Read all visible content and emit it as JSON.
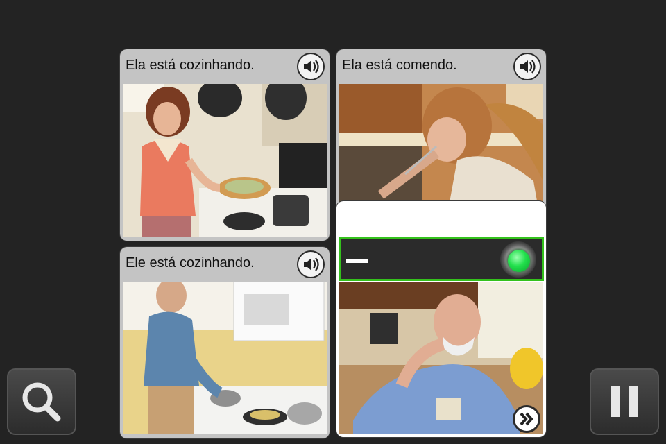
{
  "cards": [
    {
      "caption": "Ela está cozinhando.",
      "icon": "speaker-icon"
    },
    {
      "caption": "Ela está comendo.",
      "icon": "speaker-icon"
    },
    {
      "caption": "Ele está cozinhando.",
      "icon": "speaker-icon"
    }
  ],
  "answer": {
    "text": "—",
    "status_icon": "green-light-icon",
    "accent": "#34c11c"
  },
  "controls": {
    "zoom_icon": "magnifier-icon",
    "pause_icon": "pause-icon",
    "next_icon": "double-chevron-right-icon"
  }
}
